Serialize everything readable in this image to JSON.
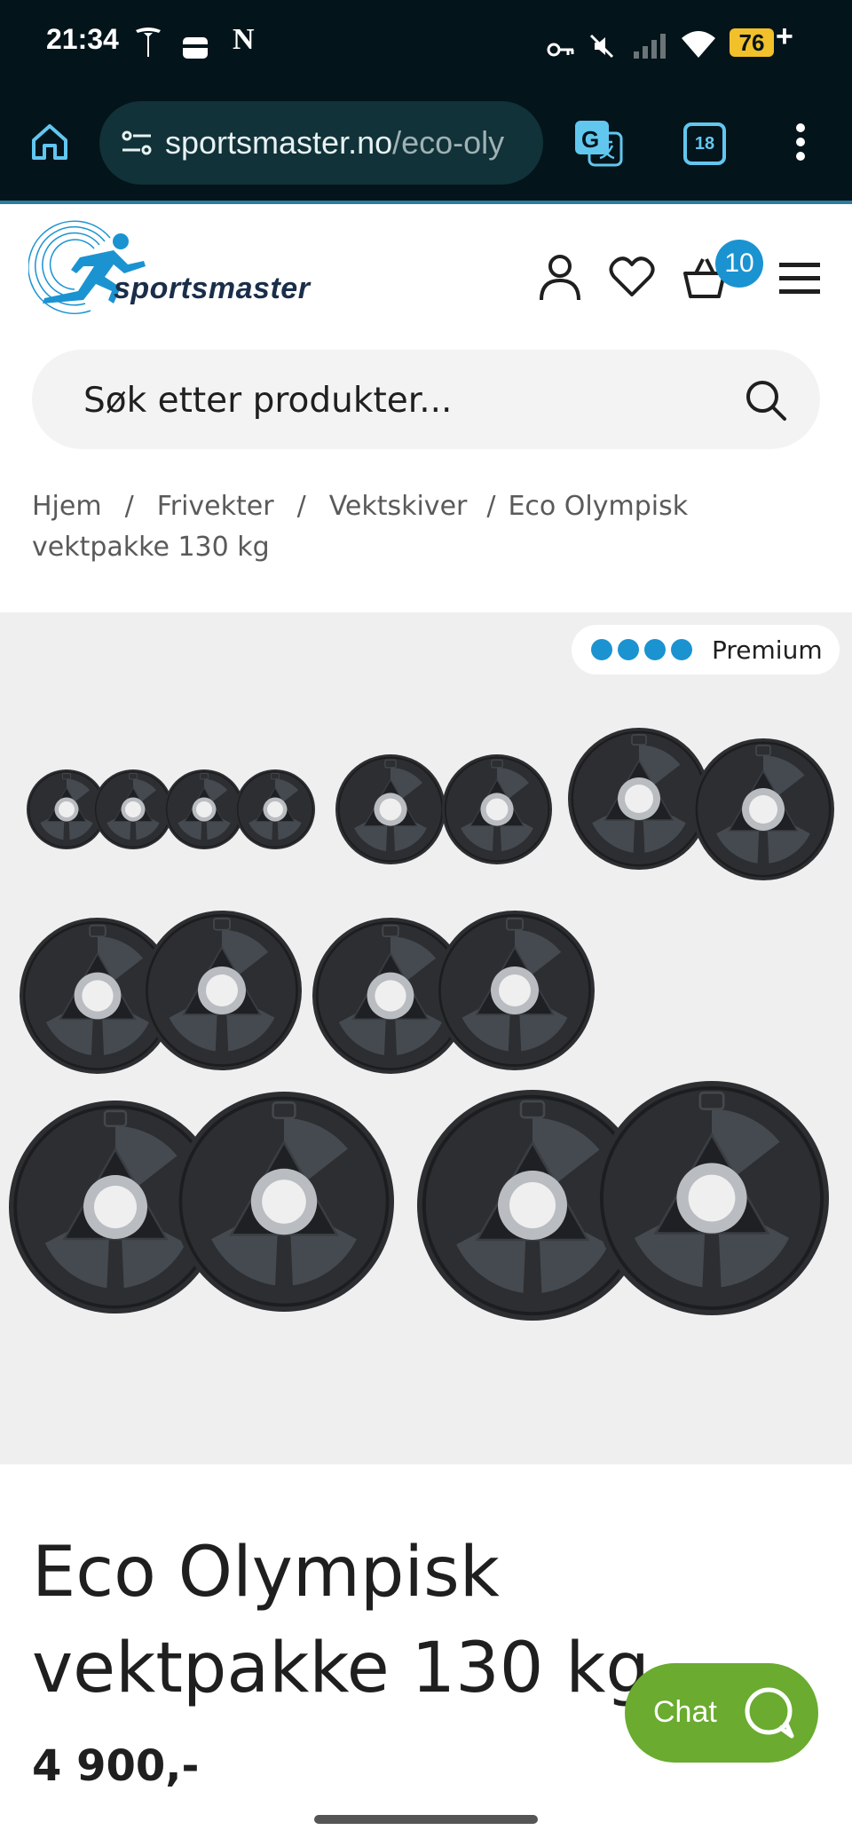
{
  "status_bar": {
    "time": "21:34",
    "notification_letter": "N",
    "battery": "76",
    "battery_charging": "+"
  },
  "browser": {
    "url_domain": "sportsmaster.no",
    "url_path": "/eco-oly",
    "tab_count": "18"
  },
  "header": {
    "logo_text": "sportsmaster",
    "cart_count": "10"
  },
  "search": {
    "placeholder": "Søk etter produkter..."
  },
  "breadcrumb": {
    "items": [
      "Hjem",
      "Frivekter",
      "Vektskiver",
      "Eco Olympisk vektpakke 130 kg"
    ],
    "separator": "/"
  },
  "product": {
    "badge_label": "Premium",
    "badge_dots": 4,
    "title": "Eco Olympisk vektpakke 130 kg",
    "price": "4 900,-"
  },
  "chat": {
    "label": "Chat"
  },
  "colors": {
    "brand_blue": "#1b93d1",
    "chat_green": "#6aab30",
    "browser_bg": "#04141b"
  }
}
